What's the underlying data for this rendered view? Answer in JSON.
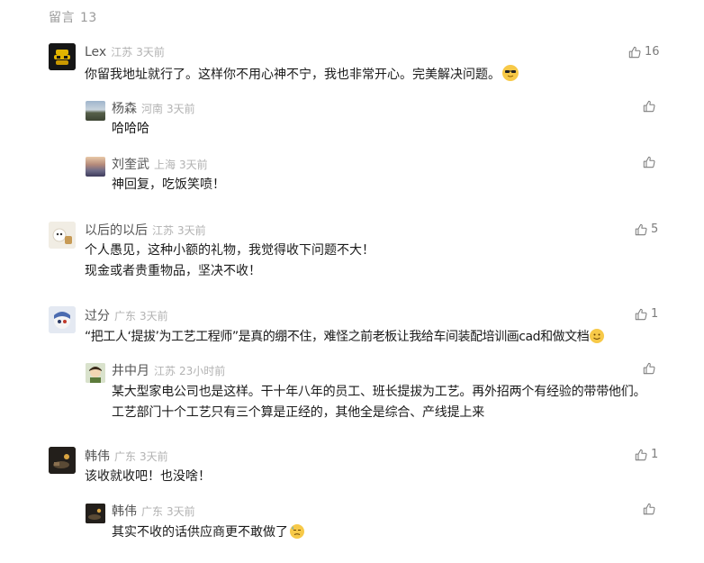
{
  "header": {
    "label": "留言",
    "count": "13"
  },
  "comments": [
    {
      "nick": "Lex",
      "loc": "江苏",
      "time": "3天前",
      "likes": "16",
      "lines": [
        "你留我地址就行了。这样你不用心神不宁，我也非常开心。完美解决问题。"
      ],
      "replies": [
        {
          "nick": "杨森",
          "loc": "河南",
          "time": "3天前",
          "lines": [
            "哈哈哈"
          ]
        },
        {
          "nick": "刘奎武",
          "loc": "上海",
          "time": "3天前",
          "lines": [
            "神回复，吃饭笑喷！"
          ]
        }
      ]
    },
    {
      "nick": "以后的以后",
      "loc": "江苏",
      "time": "3天前",
      "likes": "5",
      "lines": [
        "个人愚见，这种小额的礼物，我觉得收下问题不大！",
        "现金或者贵重物品，坚决不收！"
      ]
    },
    {
      "nick": "过分",
      "loc": "广东",
      "time": "3天前",
      "likes": "1",
      "lines": [
        "“把工人‘提拔’为工艺工程师”是真的绷不住，难怪之前老板让我给车间装配培训画cad和做文档"
      ],
      "replies": [
        {
          "nick": "井中月",
          "loc": "江苏",
          "time": "23小时前",
          "lines": [
            "某大型家电公司也是这样。干十年八年的员工、班长提拔为工艺。再外招两个有经验的带带他们。工艺部门十个工艺只有三个算是正经的，其他全是综合、产线提上来"
          ]
        }
      ]
    },
    {
      "nick": "韩伟",
      "loc": "广东",
      "time": "3天前",
      "likes": "1",
      "lines": [
        "该收就收吧！也没啥！"
      ],
      "replies": [
        {
          "nick": "韩伟",
          "loc": "广东",
          "time": "3天前",
          "lines": [
            "其实不收的话供应商更不敢做了"
          ]
        }
      ]
    }
  ],
  "icons": {
    "like": "thumbs-up-icon",
    "emoji_cool": "sunglasses-emoji-icon",
    "emoji_smile": "smile-emoji-icon",
    "emoji_cry": "sweat-emoji-icon"
  },
  "colors": {
    "text": "#1a1a1a",
    "nick": "#555555",
    "meta": "#b2b2b2",
    "emoji_yellow": "#f7c948"
  }
}
